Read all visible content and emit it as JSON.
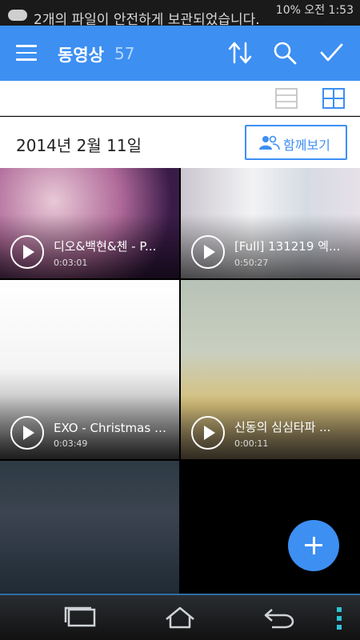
{
  "status_bar": {
    "notification_text": "2개의 파일이 안전하게 보관되었습니다.",
    "right_text": "10% 오전 1:53"
  },
  "app_bar": {
    "title": "동영상",
    "count": "57",
    "icons": [
      "menu-icon",
      "sort-icon",
      "search-icon",
      "check-icon"
    ]
  },
  "view_toggle": {
    "icons": [
      "list-view-icon",
      "grid-view-icon"
    ],
    "selected": "grid-view-icon"
  },
  "section": {
    "date": "2014년 2월 11일",
    "together_label": "함께보기"
  },
  "videos": [
    {
      "title": "디오&백현&첸 - P...",
      "duration": "0:03:01"
    },
    {
      "title": "[Full] 131219 엑...",
      "duration": "0:50:27"
    },
    {
      "title": "EXO - Christmas D...",
      "duration": "0:03:49"
    },
    {
      "title": "신동의 심심타파 ...",
      "duration": "0:00:11"
    },
    {
      "title": "",
      "duration": ""
    }
  ],
  "fab": {
    "icon": "plus-icon"
  },
  "nav_bar": {
    "icons": [
      "recent-apps-icon",
      "home-icon",
      "back-icon",
      "overflow-menu-icon"
    ]
  },
  "colors": {
    "accent": "#3d8ff2",
    "status_bar": "#1a1a1a",
    "nav_bar": "#111111"
  }
}
